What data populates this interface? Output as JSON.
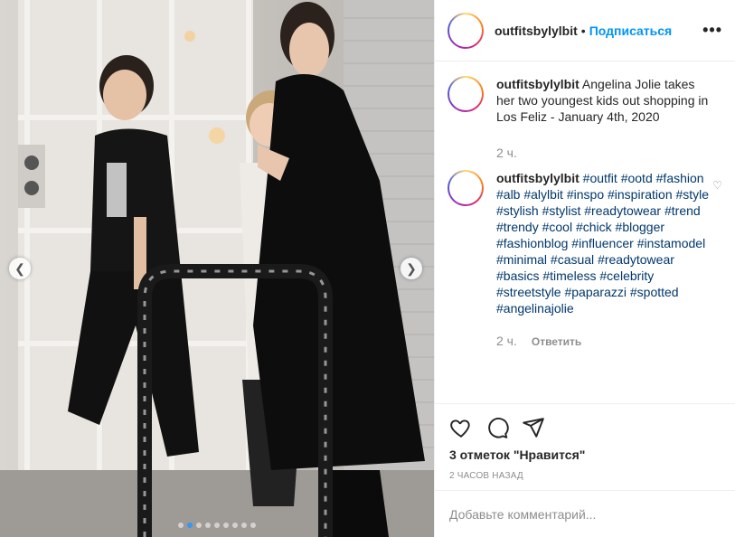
{
  "post": {
    "username": "outfitsbylylbit",
    "separator": "•",
    "follow_label": "Подписаться",
    "more_label": "•••",
    "caption": "Angelina Jolie takes her two youngest kids out shopping in Los Feliz - January 4th, 2020",
    "caption_time": "2 ч.",
    "comment_user": "outfitsbylylbit",
    "comment_time": "2 ч.",
    "reply_label": "Ответить",
    "hashtags": [
      "#outfit",
      "#ootd",
      "#fashion",
      "#alb",
      "#alylbit",
      "#inspo",
      "#inspiration",
      "#style",
      "#stylish",
      "#stylist",
      "#readytowear",
      "#trend",
      "#trendy",
      "#cool",
      "#chick",
      "#blogger",
      "#fashionblog",
      "#influencer",
      "#instamodel",
      "#minimal",
      "#casual",
      "#readytowear",
      "#basics",
      "#timeless",
      "#celebrity",
      "#streetstyle",
      "#paparazzi",
      "#spotted",
      "#angelinajolie"
    ],
    "likes_text": "3 отметок \"Нравится\"",
    "posted_ago": "2 часов назад",
    "add_comment_placeholder": "Добавьте комментарий...",
    "carousel": {
      "slide_count": 9,
      "active_index": 1
    }
  },
  "icons": {
    "like": "heart-icon",
    "comment": "comment-icon",
    "share": "share-icon",
    "more": "more-options-icon",
    "prev": "chevron-left-icon",
    "next": "chevron-right-icon"
  },
  "colors": {
    "link": "#00376b",
    "follow": "#0095f6",
    "muted": "#8e8e8e",
    "carousel_active": "#3897f0"
  }
}
